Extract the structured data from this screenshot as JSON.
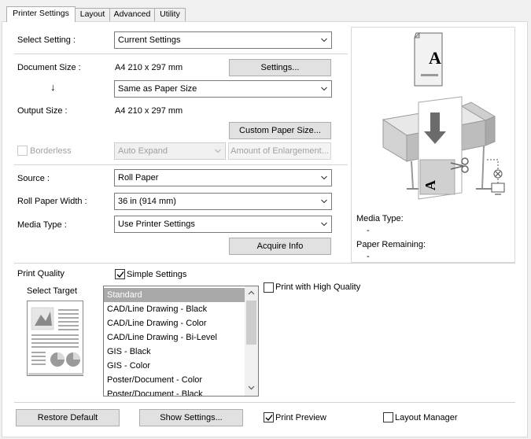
{
  "tabs": [
    {
      "label": "Printer Settings",
      "active": true
    },
    {
      "label": "Layout",
      "active": false
    },
    {
      "label": "Advanced",
      "active": false
    },
    {
      "label": "Utility",
      "active": false
    }
  ],
  "select_setting": {
    "label": "Select Setting :",
    "value": "Current Settings"
  },
  "document_size": {
    "label": "Document Size :",
    "value": "A4 210 x 297 mm",
    "settings_button": "Settings..."
  },
  "arrow_glyph": "↓",
  "size_mode": {
    "value": "Same as Paper Size"
  },
  "output_size": {
    "label": "Output Size :",
    "value": "A4 210 x 297 mm",
    "custom_button": "Custom Paper Size..."
  },
  "borderless": {
    "label": "Borderless",
    "checked": false,
    "expand_value": "Auto Expand",
    "enlargement_button": "Amount of Enlargement..."
  },
  "source": {
    "label": "Source :",
    "value": "Roll Paper"
  },
  "roll_width": {
    "label": "Roll Paper Width :",
    "value": "36 in (914 mm)"
  },
  "media_type": {
    "label": "Media Type :",
    "value": "Use Printer Settings",
    "acquire_button": "Acquire Info"
  },
  "preview": {
    "paper_letter": "A",
    "media_type_label": "Media Type:",
    "media_type_value": "-",
    "paper_remaining_label": "Paper Remaining:",
    "paper_remaining_value": "-"
  },
  "print_quality": {
    "label": "Print Quality",
    "simple_settings": {
      "label": "Simple Settings",
      "checked": true
    },
    "high_quality": {
      "label": "Print with High Quality",
      "checked": false
    },
    "select_target_label": "Select Target",
    "targets": [
      "Standard",
      "CAD/Line Drawing - Black",
      "CAD/Line Drawing - Color",
      "CAD/Line Drawing - Bi-Level",
      "GIS - Black",
      "GIS - Color",
      "Poster/Document - Color",
      "Poster/Document - Black"
    ],
    "selected_target": "Standard"
  },
  "footer": {
    "restore_button": "Restore Default",
    "show_settings_button": "Show Settings...",
    "print_preview": {
      "label": "Print Preview",
      "checked": true
    },
    "layout_manager": {
      "label": "Layout Manager",
      "checked": false
    }
  },
  "icons": {
    "dropdown": "chevron-down-icon",
    "check": "checkmark-icon",
    "printer": "printer-illustration"
  }
}
